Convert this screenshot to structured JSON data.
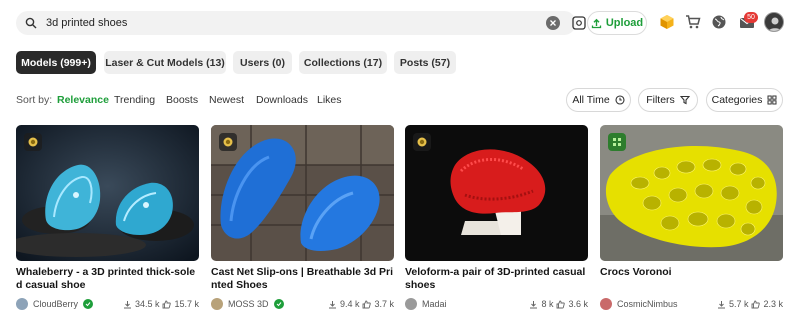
{
  "header": {
    "search_value": "3d printed shoes",
    "upload_label": "Upload",
    "notification_count": "50",
    "icons": [
      "search-icon",
      "clear-icon",
      "image-search-icon",
      "upload-icon",
      "cube-icon",
      "cart-icon",
      "globe-icon",
      "mail-icon",
      "avatar"
    ]
  },
  "tabs": [
    {
      "label": "Models (999+)",
      "active": true
    },
    {
      "label": "Laser & Cut Models (13)"
    },
    {
      "label": "Users (0)"
    },
    {
      "label": "Collections (17)"
    },
    {
      "label": "Posts (57)"
    }
  ],
  "sort": {
    "label": "Sort by:",
    "options": [
      "Relevance",
      "Trending",
      "Boosts",
      "Newest",
      "Downloads",
      "Likes"
    ],
    "active": "Relevance"
  },
  "filters": {
    "time_label": "All Time",
    "filters_label": "Filters",
    "categories_label": "Categories"
  },
  "cards": [
    {
      "title": "Whaleberry - a 3D printed thick-soled casual shoe",
      "author": "CloudBerry",
      "verified": true,
      "downloads": "34.5 k",
      "likes": "15.7 k"
    },
    {
      "title": "Cast Net Slip-ons | Breathable 3d Printed Shoes",
      "author": "MOSS 3D",
      "verified": true,
      "downloads": "9.4 k",
      "likes": "3.7 k"
    },
    {
      "title": "Veloform-a pair of 3D-printed casual shoes",
      "author": "Madai",
      "verified": false,
      "downloads": "8 k",
      "likes": "3.6 k"
    },
    {
      "title": "Crocs Voronoi",
      "author": "CosmicNimbus",
      "verified": false,
      "downloads": "5.7 k",
      "likes": "2.3 k"
    }
  ],
  "colors": {
    "accent": "#1e9e3a",
    "dark_tab": "#2a2a2a",
    "badge": "#e53935"
  }
}
